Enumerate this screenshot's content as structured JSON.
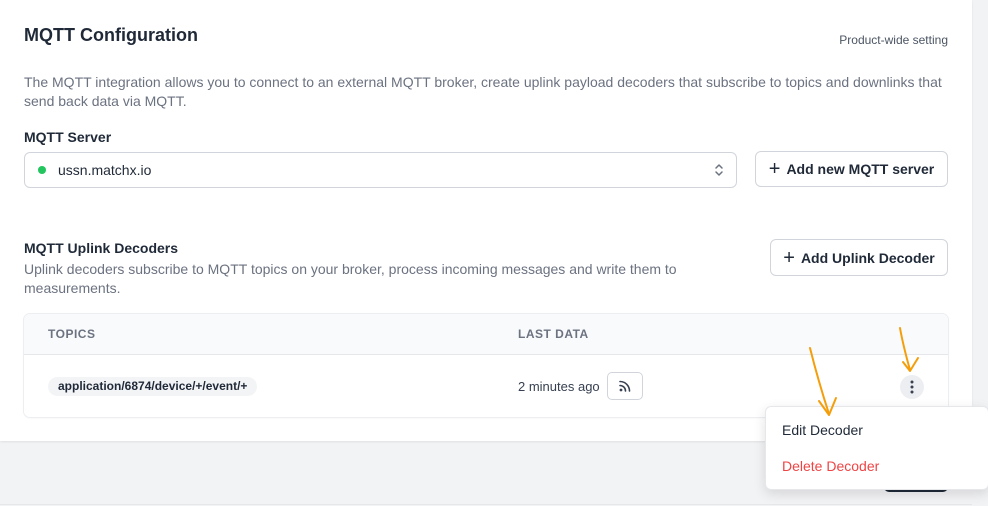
{
  "header": {
    "title": "MQTT Configuration",
    "scope": "Product-wide setting"
  },
  "description": "The MQTT integration allows you to connect to an external MQTT broker, create uplink payload decoders that subscribe to topics and downlinks that send back data via MQTT.",
  "server": {
    "label": "MQTT Server",
    "selected_value": "ussn.matchx.io",
    "status_color": "#22c55e",
    "add_button_label": "Add new MQTT server"
  },
  "decoders": {
    "title": "MQTT Uplink Decoders",
    "description": "Uplink decoders subscribe to MQTT topics on your broker, process incoming messages and write them to measurements.",
    "add_button_label": "Add Uplink Decoder",
    "columns": [
      "TOPICS",
      "LAST DATA"
    ],
    "rows": [
      {
        "topic": "application/6874/device/+/event/+",
        "last_data": "2 minutes ago"
      }
    ]
  },
  "context_menu": {
    "items": [
      {
        "label": "Edit Decoder",
        "color": "#1f2937"
      },
      {
        "label": "Delete Decoder",
        "color": "#ef4444"
      }
    ]
  },
  "icons": {
    "plus": "+",
    "select_arrows": "chevron-up-down-icon",
    "feed": "rss-feed-icon",
    "row_menu": "more-vertical-icon"
  },
  "annotation_color": "#f59e0b"
}
